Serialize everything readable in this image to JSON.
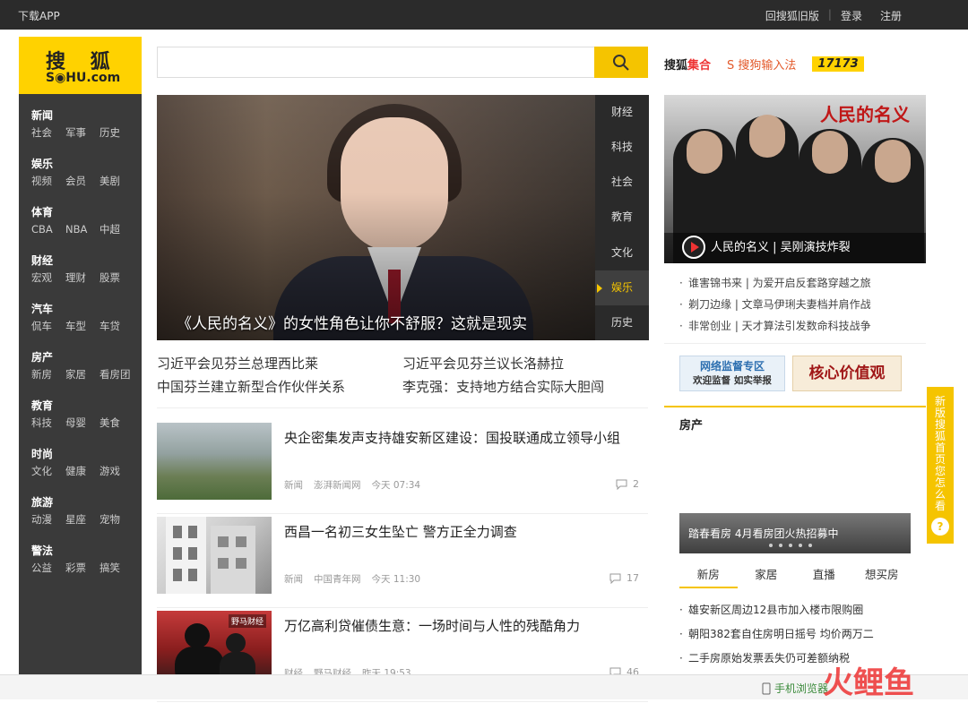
{
  "topbar": {
    "download_app": "下载APP",
    "old_version": "回搜狐旧版",
    "login": "登录",
    "register": "注册"
  },
  "logo": {
    "line1": "搜 狐",
    "line2": "S◉HU.com"
  },
  "left_nav": [
    {
      "head": "新闻",
      "subs": [
        "社会",
        "军事",
        "历史"
      ]
    },
    {
      "head": "娱乐",
      "subs": [
        "视频",
        "会员",
        "美剧"
      ]
    },
    {
      "head": "体育",
      "subs": [
        "CBA",
        "NBA",
        "中超"
      ]
    },
    {
      "head": "财经",
      "subs": [
        "宏观",
        "理财",
        "股票"
      ]
    },
    {
      "head": "汽车",
      "subs": [
        "侃车",
        "车型",
        "车贷"
      ]
    },
    {
      "head": "房产",
      "subs": [
        "新房",
        "家居",
        "看房团"
      ]
    },
    {
      "head": "教育",
      "subs": [
        "科技",
        "母婴",
        "美食"
      ]
    },
    {
      "head": "时尚",
      "subs": [
        "文化",
        "健康",
        "游戏"
      ]
    },
    {
      "head": "旅游",
      "subs": [
        "动漫",
        "星座",
        "宠物"
      ]
    },
    {
      "head": "警法",
      "subs": [
        "公益",
        "彩票",
        "搞笑"
      ]
    }
  ],
  "search": {
    "value": "",
    "icon": "search-icon"
  },
  "hero": {
    "caption": "《人民的名义》的女性角色让你不舒服？这就是现实",
    "channels": [
      "财经",
      "科技",
      "社会",
      "教育",
      "文化",
      "娱乐",
      "历史"
    ],
    "active_channel": "娱乐"
  },
  "headlines": [
    [
      "习近平会见芬兰总理西比莱",
      "习近平会见芬兰议长洛赫拉"
    ],
    [
      "中国芬兰建立新型合作伙伴关系",
      "李克强：支持地方结合实际大胆闯"
    ]
  ],
  "feed": [
    {
      "title": "央企密集发声支持雄安新区建设：国投联通成立领导小组",
      "channel": "新闻",
      "source": "澎湃新闻网",
      "time": "今天 07:34",
      "comments": "2"
    },
    {
      "title": "西昌一名初三女生坠亡 警方正全力调查",
      "channel": "新闻",
      "source": "中国青年网",
      "time": "今天 11:30",
      "comments": "17"
    },
    {
      "title": "万亿高利贷催债生意：一场时间与人性的残酷角力",
      "channel": "财经",
      "source": "野马财经",
      "time": "昨天 19:53",
      "comments": "46",
      "thumb_tag": "野马财经"
    }
  ],
  "partners": {
    "p1_a": "搜狐",
    "p1_b": "集合",
    "p2": "S 搜狗输入法",
    "p3": "17173"
  },
  "right_hero": {
    "title_art": "人民的名义",
    "caption": "人民的名义 | 吴刚演技炸裂"
  },
  "right_links": [
    "谁害锦书来 | 为爱开启反套路穿越之旅",
    "剃刀边缘 | 文章马伊琍夫妻档并肩作战",
    "非常创业 | 天才算法引发数命科技战争"
  ],
  "banners": {
    "b1_line1": "网络监督专区",
    "b1_line2": "欢迎监督  如实举报",
    "b2": "核心价值观"
  },
  "house": {
    "title": "房产",
    "slide_caption": "踏春看房 4月看房团火热招募中",
    "tabs": [
      "新房",
      "家居",
      "直播",
      "想买房"
    ],
    "active_tab": "新房",
    "links": [
      "雄安新区周边12县市加入楼市限购圈",
      "朝阳382套自住房明日摇号 均价两万二",
      "二手房原始发票丢失仍可差额纳税"
    ]
  },
  "promo": {
    "text": "新版搜狐首页您怎么看",
    "q": "?"
  },
  "bottombar": {
    "mobile": "手机浏览器",
    "watermark": "火鲤鱼"
  }
}
